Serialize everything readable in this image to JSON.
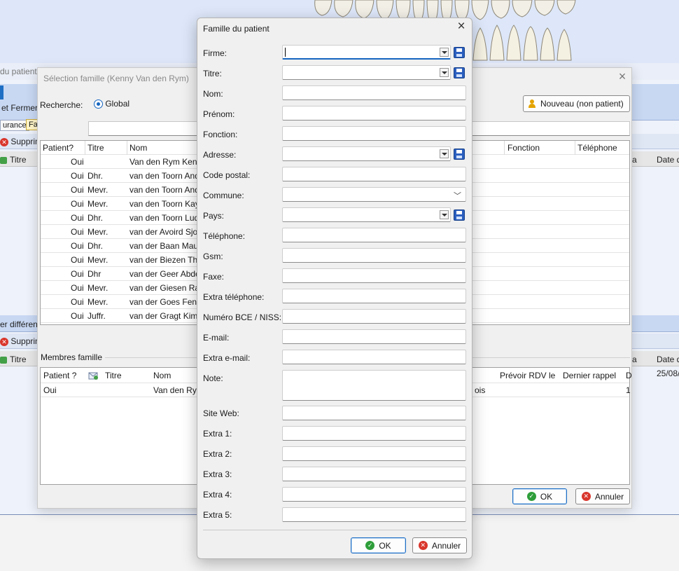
{
  "background_app": {
    "window_title": "du patient",
    "toolbar_close_label": "et Fermer",
    "tab_assurance": "urance",
    "tab_famille": "Fa",
    "delete_label_1": "Supprim",
    "col_titre_1": "Titre",
    "delete_label_2": "Supprim",
    "col_titre_2": "Titre",
    "band_text": "er différent",
    "right_col_a": "a",
    "right_col_date_1": "Date d",
    "right_col_b": "a",
    "right_col_date_2": "Date d",
    "right_val_date": "25/08/"
  },
  "selection_dialog": {
    "title": "Sélection famille (Kenny Van den Rym)",
    "search_label": "Recherche:",
    "radio_label": "Global",
    "new_button": "Nouveau (non patient)",
    "grid_headers": [
      "Patient?",
      "Titre",
      "Nom",
      "Fonction",
      "Téléphone"
    ],
    "grid_rows": [
      {
        "patient": "Oui",
        "titre": "",
        "nom": "Van den Rym Kenn"
      },
      {
        "patient": "Oui",
        "titre": "Dhr.",
        "nom": "van den Toorn And"
      },
      {
        "patient": "Oui",
        "titre": "Mevr.",
        "nom": "van den Toorn And"
      },
      {
        "patient": "Oui",
        "titre": "Mevr.",
        "nom": "van den Toorn Kay"
      },
      {
        "patient": "Oui",
        "titre": "Dhr.",
        "nom": "van den Toorn Lud"
      },
      {
        "patient": "Oui",
        "titre": "Mevr.",
        "nom": "van der Avoird Sjo"
      },
      {
        "patient": "Oui",
        "titre": "Dhr.",
        "nom": "van der Baan Maur"
      },
      {
        "patient": "Oui",
        "titre": "Mevr.",
        "nom": "van der Biezen Tha"
      },
      {
        "patient": "Oui",
        "titre": "Dhr",
        "nom": "van der Geer Abde"
      },
      {
        "patient": "Oui",
        "titre": "Mevr.",
        "nom": "van der Giesen Raf"
      },
      {
        "patient": "Oui",
        "titre": "Mevr.",
        "nom": "van der Goes Fenn"
      },
      {
        "patient": "Oui",
        "titre": "Juffr.",
        "nom": "van der Gragt Kim"
      }
    ],
    "members_label": "Membres famille",
    "members_headers": {
      "patient": "Patient ?",
      "titre": "Titre",
      "nom": "Nom",
      "prevoir": "Prévoir RDV le",
      "dernier": "Dernier rappel",
      "d": "D"
    },
    "members_row": {
      "patient": "Oui",
      "nom": "Van den Ryn",
      "extra": "ois",
      "d": "1"
    },
    "ok_button": "OK",
    "cancel_button": "Annuler"
  },
  "famille_dialog": {
    "title": "Famille du patient",
    "fields": {
      "firme": {
        "label": "Firme:",
        "value": ""
      },
      "titre": {
        "label": "Titre:",
        "value": ""
      },
      "nom": {
        "label": "Nom:",
        "value": ""
      },
      "prenom": {
        "label": "Prénom:",
        "value": ""
      },
      "fonction": {
        "label": "Fonction:",
        "value": ""
      },
      "adresse": {
        "label": "Adresse:",
        "value": ""
      },
      "code_postal": {
        "label": "Code postal:",
        "value": ""
      },
      "commune": {
        "label": "Commune:",
        "value": ""
      },
      "pays": {
        "label": "Pays:",
        "value": ""
      },
      "telephone": {
        "label": "Téléphone:",
        "value": ""
      },
      "gsm": {
        "label": "Gsm:",
        "value": ""
      },
      "faxe": {
        "label": "Faxe:",
        "value": ""
      },
      "extra_telephone": {
        "label": "Extra téléphone:",
        "value": ""
      },
      "numero_bce": {
        "label": "Numéro BCE / NISS:",
        "value": ""
      },
      "email": {
        "label": "E-mail:",
        "value": ""
      },
      "extra_email": {
        "label": "Extra e-mail:",
        "value": ""
      },
      "note": {
        "label": "Note:",
        "value": ""
      },
      "site_web": {
        "label": "Site Web:",
        "value": ""
      },
      "extra1": {
        "label": "Extra 1:",
        "value": ""
      },
      "extra2": {
        "label": "Extra 2:",
        "value": ""
      },
      "extra3": {
        "label": "Extra 3:",
        "value": ""
      },
      "extra4": {
        "label": "Extra 4:",
        "value": ""
      },
      "extra5": {
        "label": "Extra 5:",
        "value": ""
      }
    },
    "ok_button": "OK",
    "cancel_button": "Annuler"
  },
  "colors": {
    "accent": "#1565c0",
    "ok_green": "#2e9e3a",
    "cancel_red": "#d9362c",
    "save_blue": "#2b5fbf"
  }
}
